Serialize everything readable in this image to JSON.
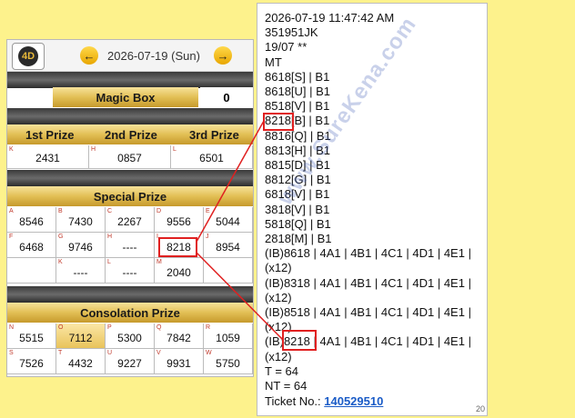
{
  "header": {
    "date": "2026-07-19 (Sun)",
    "logo_text": "4D"
  },
  "magic_box": {
    "label": "Magic Box",
    "value": "0"
  },
  "top_prizes": {
    "labels": [
      "1st Prize",
      "2nd Prize",
      "3rd Prize"
    ],
    "cells": [
      {
        "l": "K",
        "v": "2431"
      },
      {
        "l": "H",
        "v": "0857"
      },
      {
        "l": "L",
        "v": "6501"
      }
    ]
  },
  "special": {
    "title": "Special Prize",
    "cells": [
      {
        "l": "A",
        "v": "8546"
      },
      {
        "l": "B",
        "v": "7430"
      },
      {
        "l": "C",
        "v": "2267"
      },
      {
        "l": "D",
        "v": "9556"
      },
      {
        "l": "E",
        "v": "5044"
      },
      {
        "l": "F",
        "v": "6468"
      },
      {
        "l": "G",
        "v": "9746"
      },
      {
        "l": "H",
        "v": "----"
      },
      {
        "l": "I",
        "v": "8218"
      },
      {
        "l": "J",
        "v": "8954"
      },
      {
        "l": "",
        "v": ""
      },
      {
        "l": "K",
        "v": "----"
      },
      {
        "l": "L",
        "v": "----"
      },
      {
        "l": "M",
        "v": "2040"
      },
      {
        "l": "",
        "v": ""
      }
    ]
  },
  "consolation": {
    "title": "Consolation Prize",
    "cells": [
      {
        "l": "N",
        "v": "5515"
      },
      {
        "l": "O",
        "v": "7112"
      },
      {
        "l": "P",
        "v": "5300"
      },
      {
        "l": "Q",
        "v": "7842"
      },
      {
        "l": "R",
        "v": "1059"
      },
      {
        "l": "S",
        "v": "7526"
      },
      {
        "l": "T",
        "v": "4432"
      },
      {
        "l": "U",
        "v": "9227"
      },
      {
        "l": "V",
        "v": "9931"
      },
      {
        "l": "W",
        "v": "5750"
      }
    ]
  },
  "receipt": {
    "lines": [
      "2026-07-19 11:47:42 AM",
      "351951JK",
      "19/07 **",
      "MT",
      "8618[S] | B1",
      "8618[U] | B1",
      "8518[V] | B1",
      "8218[B] | B1",
      "8816[Q] | B1",
      "8813[H] | B1",
      "8815[D] | B1",
      "8812[G] | B1",
      "6818[V] | B1",
      "3818[V] | B1",
      "5818[Q] | B1",
      "2818[M] | B1",
      "(IB)8618 | 4A1 | 4B1 | 4C1 | 4D1 | 4E1 |",
      "(x12)",
      "(IB)8318 | 4A1 | 4B1 | 4C1 | 4D1 | 4E1 |",
      "(x12)",
      "(IB)8518 | 4A1 | 4B1 | 4C1 | 4D1 | 4E1 |",
      "(x12)",
      "(IB)8218 | 4A1 | 4B1 | 4C1 | 4D1 | 4E1 |",
      "(x12)",
      "T = 64",
      "NT = 64"
    ],
    "ticket_label": "Ticket No.: ",
    "ticket_no": "140529510",
    "page": "20"
  },
  "watermark": "www.SureKena.com",
  "colors": {
    "highlight": "#e02020",
    "link": "#1b5cc7",
    "background": "#fdf28c"
  }
}
